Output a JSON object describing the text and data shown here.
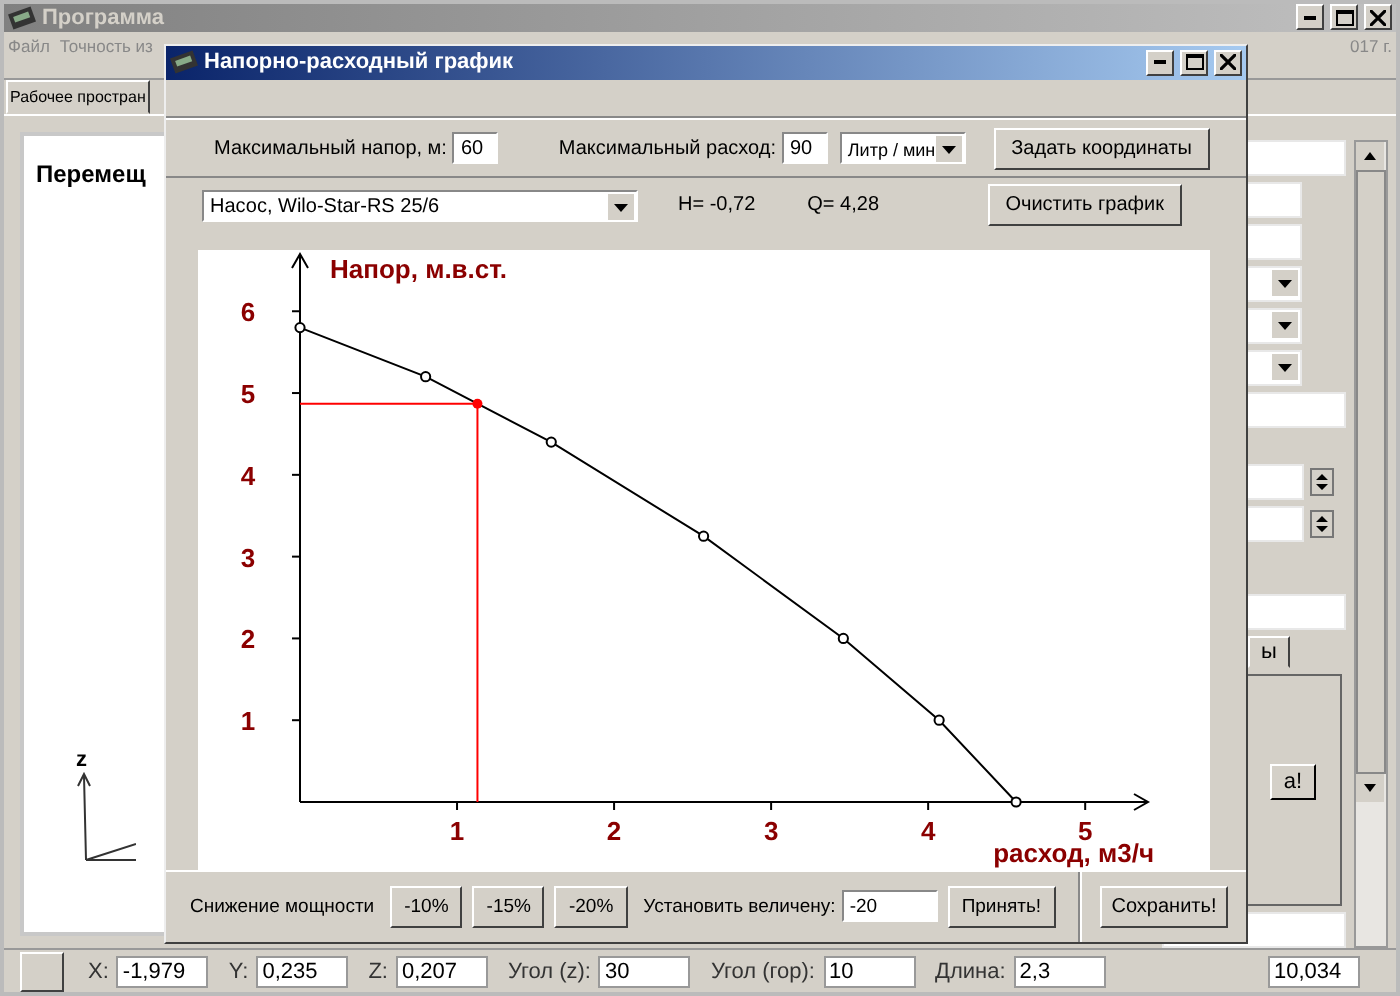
{
  "main_window": {
    "title": "Программа",
    "menu": [
      "Файл",
      "Точность из"
    ],
    "menu_right": "017 г.",
    "tab": "Рабочее простран",
    "panel_title": "Перемещ",
    "axis_label": "z",
    "status": [
      {
        "label": "X:",
        "value": "-1,979"
      },
      {
        "label": "Y:",
        "value": "0,235"
      },
      {
        "label": "Z:",
        "value": "0,207"
      },
      {
        "label": "Угол (z):",
        "value": "30"
      },
      {
        "label": "Угол (гор):",
        "value": "10"
      },
      {
        "label": "Длина:",
        "value": "2,3"
      }
    ],
    "tab_fragment": "ы",
    "button_fragment": "а!",
    "bottom_value": "10,034"
  },
  "dialog": {
    "title": "Напорно-расходный график",
    "max_head": {
      "label": "Максимальный напор, м:",
      "value": "60"
    },
    "max_flow": {
      "label": "Максимальный расход:",
      "value": "90",
      "unit": "Литр / мин"
    },
    "set_coords_button": "Задать координаты",
    "pump": "Насос, Wilo-Star-RS 25/6",
    "h_reading": "H= -0,72",
    "q_reading": "Q= 4,28",
    "clear_button": "Очистить график",
    "chart_data": {
      "type": "line",
      "xlabel": "расход, м3/ч",
      "ylabel": "Напор, м.в.ст.",
      "xlim": [
        0,
        5.4
      ],
      "ylim": [
        0,
        6.7
      ],
      "xticks": [
        1,
        2,
        3,
        4,
        5
      ],
      "yticks": [
        1,
        2,
        3,
        4,
        5,
        6
      ],
      "x": [
        0,
        0.8,
        1.6,
        2.57,
        3.46,
        4.07,
        4.56
      ],
      "series": [
        {
          "color": "#000000",
          "marker": "o",
          "values": [
            5.8,
            5.2,
            4.4,
            3.25,
            2.0,
            1.0,
            0
          ]
        }
      ],
      "ref_lines": [
        {
          "axis": "y",
          "value": 4.87,
          "color": "#ff0000"
        },
        {
          "axis": "x",
          "value": 1.13,
          "color": "#ff0000"
        }
      ]
    },
    "power_label": "Снижение мощности",
    "power_buttons": [
      "-10%",
      "-15%",
      "-20%"
    ],
    "set_value": {
      "label": "Установить величену:",
      "value": "-20"
    },
    "apply_button": "Принять!",
    "save_button": "Сохранить!"
  }
}
